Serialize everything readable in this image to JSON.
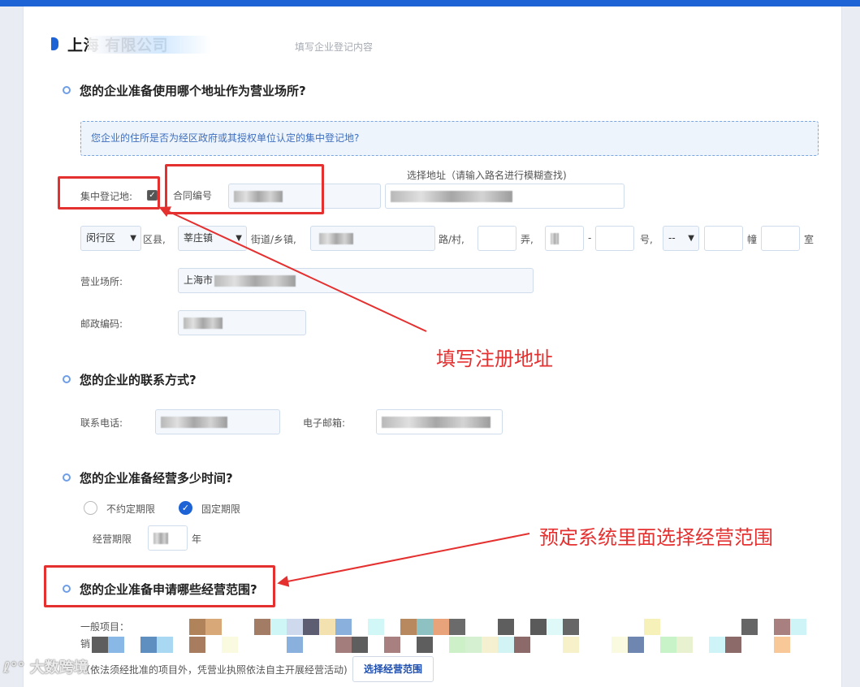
{
  "header": {
    "company": "上海 有限公司",
    "subtitle": "填写企业登记内容"
  },
  "section_address": {
    "question": "您的企业准备使用哪个地址作为营业场所?",
    "info": "您企业的住所是否为经区政府或其授权单位认定的集中登记地?",
    "address_search_label": "选择地址（请输入路名进行模糊查找)",
    "centralized_label": "集中登记地:",
    "centralized_checked": true,
    "contract_label": "合同编号",
    "district_value": "闵行区",
    "district_suffix": "区县,",
    "town_value": "莘庄镇",
    "town_suffix": "街道/乡镇,",
    "road_suffix": "路/村,",
    "lane_suffix": "弄,",
    "dash": "-",
    "number_suffix": "号,",
    "dash_select_value": "--",
    "building_suffix": "幢",
    "room_suffix": "室",
    "premises_label": "营业场所:",
    "premises_value": "上海市",
    "postcode_label": "邮政编码:"
  },
  "section_contact": {
    "question": "您的企业的联系方式?",
    "phone_label": "联系电话:",
    "email_label": "电子邮箱:"
  },
  "section_term": {
    "question": "您的企业准备经营多少时间?",
    "option_unlimited": "不约定期限",
    "option_fixed": "固定期限",
    "selected": "固定期限",
    "period_label": "经营期限",
    "year_unit": "年"
  },
  "section_scope": {
    "question": "您的企业准备申请哪些经营范围?",
    "general_label": "一般项目：",
    "second_line_start": "销",
    "note": "（依法须经批准的项目外，凭营业执照依法自主开展经营活动)",
    "select_button": "选择经营范围"
  },
  "annotations": {
    "fill_address": "填写注册地址",
    "choose_scope": "预定系统里面选择经营范围"
  },
  "watermark": "大数跨境",
  "colors": {
    "accent": "#1e63d6",
    "annotation_red": "#e53030",
    "info_bg": "#eef4fc"
  }
}
